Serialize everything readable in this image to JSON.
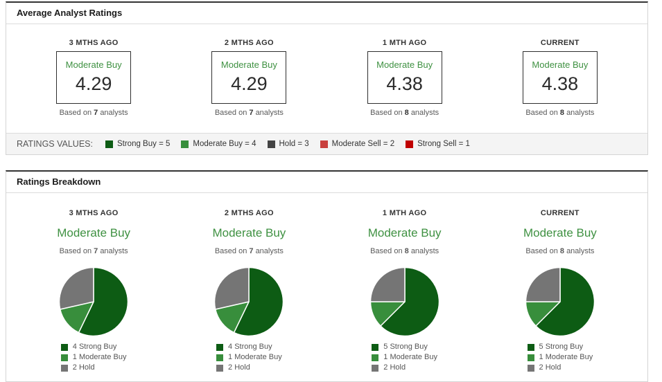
{
  "colors": {
    "strong_buy": "#0d5c14",
    "moderate_buy": "#388e3c",
    "hold_dark": "#444444",
    "hold": "#757575",
    "moderate_sell": "#c9403d",
    "strong_sell": "#c00000",
    "rating_green": "#3f9142"
  },
  "labels": {
    "based_on": "Based on",
    "analysts": "analysts"
  },
  "avg_panel": {
    "title": "Average Analyst Ratings",
    "columns": [
      {
        "period": "3 MTHS AGO",
        "rating": "Moderate Buy",
        "value": "4.29",
        "analyst_count": "7"
      },
      {
        "period": "2 MTHS AGO",
        "rating": "Moderate Buy",
        "value": "4.29",
        "analyst_count": "7"
      },
      {
        "period": "1 MTH AGO",
        "rating": "Moderate Buy",
        "value": "4.38",
        "analyst_count": "8"
      },
      {
        "period": "CURRENT",
        "rating": "Moderate Buy",
        "value": "4.38",
        "analyst_count": "8"
      }
    ],
    "ratings_values": {
      "label": "RATINGS VALUES:",
      "items": [
        {
          "text": "Strong Buy = 5",
          "color_key": "strong_buy"
        },
        {
          "text": "Moderate Buy = 4",
          "color_key": "moderate_buy"
        },
        {
          "text": "Hold = 3",
          "color_key": "hold_dark"
        },
        {
          "text": "Moderate Sell = 2",
          "color_key": "moderate_sell"
        },
        {
          "text": "Strong Sell = 1",
          "color_key": "strong_sell"
        }
      ]
    }
  },
  "breakdown_panel": {
    "title": "Ratings Breakdown",
    "columns": [
      {
        "period": "3 MTHS AGO",
        "rating": "Moderate Buy",
        "analyst_count": "7",
        "pie": {
          "slices": [
            {
              "value": 4,
              "color_key": "strong_buy"
            },
            {
              "value": 1,
              "color_key": "moderate_buy"
            },
            {
              "value": 2,
              "color_key": "hold"
            }
          ]
        },
        "legend": [
          {
            "text": "4 Strong Buy",
            "color_key": "strong_buy"
          },
          {
            "text": "1 Moderate Buy",
            "color_key": "moderate_buy"
          },
          {
            "text": "2 Hold",
            "color_key": "hold"
          }
        ]
      },
      {
        "period": "2 MTHS AGO",
        "rating": "Moderate Buy",
        "analyst_count": "7",
        "pie": {
          "slices": [
            {
              "value": 4,
              "color_key": "strong_buy"
            },
            {
              "value": 1,
              "color_key": "moderate_buy"
            },
            {
              "value": 2,
              "color_key": "hold"
            }
          ]
        },
        "legend": [
          {
            "text": "4 Strong Buy",
            "color_key": "strong_buy"
          },
          {
            "text": "1 Moderate Buy",
            "color_key": "moderate_buy"
          },
          {
            "text": "2 Hold",
            "color_key": "hold"
          }
        ]
      },
      {
        "period": "1 MTH AGO",
        "rating": "Moderate Buy",
        "analyst_count": "8",
        "pie": {
          "slices": [
            {
              "value": 5,
              "color_key": "strong_buy"
            },
            {
              "value": 1,
              "color_key": "moderate_buy"
            },
            {
              "value": 2,
              "color_key": "hold"
            }
          ]
        },
        "legend": [
          {
            "text": "5 Strong Buy",
            "color_key": "strong_buy"
          },
          {
            "text": "1 Moderate Buy",
            "color_key": "moderate_buy"
          },
          {
            "text": "2 Hold",
            "color_key": "hold"
          }
        ]
      },
      {
        "period": "CURRENT",
        "rating": "Moderate Buy",
        "analyst_count": "8",
        "pie": {
          "slices": [
            {
              "value": 5,
              "color_key": "strong_buy"
            },
            {
              "value": 1,
              "color_key": "moderate_buy"
            },
            {
              "value": 2,
              "color_key": "hold"
            }
          ]
        },
        "legend": [
          {
            "text": "5 Strong Buy",
            "color_key": "strong_buy"
          },
          {
            "text": "1 Moderate Buy",
            "color_key": "moderate_buy"
          },
          {
            "text": "2 Hold",
            "color_key": "hold"
          }
        ]
      }
    ]
  },
  "chart_data": [
    {
      "type": "table",
      "title": "Average Analyst Ratings",
      "categories": [
        "3 MTHS AGO",
        "2 MTHS AGO",
        "1 MTH AGO",
        "CURRENT"
      ],
      "values": [
        4.29,
        4.29,
        4.38,
        4.38
      ],
      "ratings": [
        "Moderate Buy",
        "Moderate Buy",
        "Moderate Buy",
        "Moderate Buy"
      ],
      "analyst_counts": [
        7,
        7,
        8,
        8
      ],
      "scale": {
        "Strong Buy": 5,
        "Moderate Buy": 4,
        "Hold": 3,
        "Moderate Sell": 2,
        "Strong Sell": 1
      }
    },
    {
      "type": "pie",
      "title": "3 MTHS AGO",
      "labels": [
        "Strong Buy",
        "Moderate Buy",
        "Hold"
      ],
      "values": [
        4,
        1,
        2
      ],
      "legend_position": "bottom"
    },
    {
      "type": "pie",
      "title": "2 MTHS AGO",
      "labels": [
        "Strong Buy",
        "Moderate Buy",
        "Hold"
      ],
      "values": [
        4,
        1,
        2
      ],
      "legend_position": "bottom"
    },
    {
      "type": "pie",
      "title": "1 MTH AGO",
      "labels": [
        "Strong Buy",
        "Moderate Buy",
        "Hold"
      ],
      "values": [
        5,
        1,
        2
      ],
      "legend_position": "bottom"
    },
    {
      "type": "pie",
      "title": "CURRENT",
      "labels": [
        "Strong Buy",
        "Moderate Buy",
        "Hold"
      ],
      "values": [
        5,
        1,
        2
      ],
      "legend_position": "bottom"
    }
  ]
}
